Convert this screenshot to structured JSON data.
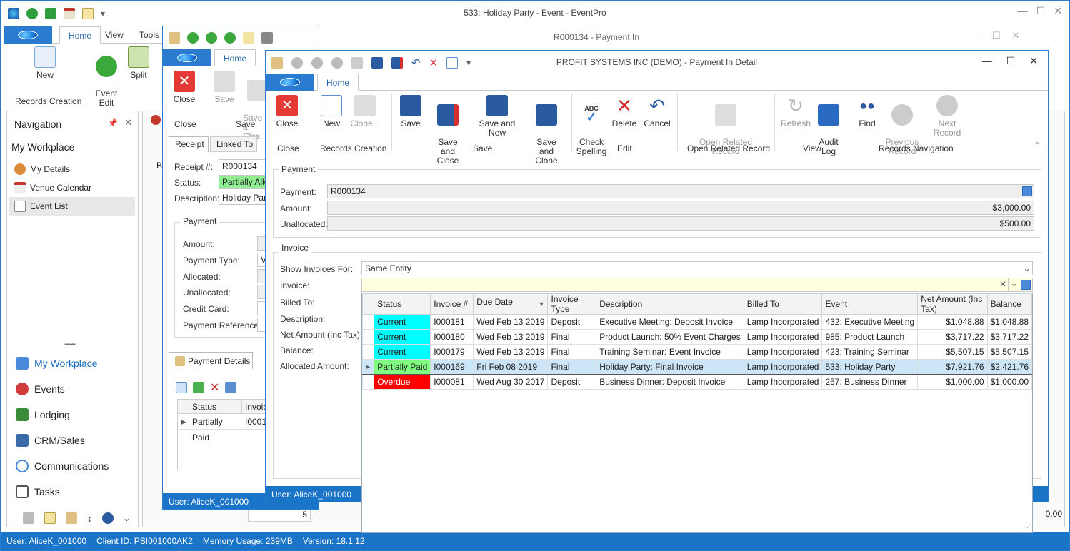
{
  "main": {
    "title": "533: Holiday Party - Event - EventPro",
    "tabs": [
      "Home",
      "View",
      "Tools"
    ],
    "ribbon": {
      "new": "New",
      "event_edit": "Event\nEdit",
      "split": "Split",
      "group": "Records Creation"
    },
    "navigation": {
      "title": "Navigation",
      "section": "My Workplace",
      "items": [
        "My Details",
        "Venue Calendar",
        "Event List"
      ],
      "modules": [
        "My Workplace",
        "Events",
        "Lodging",
        "CRM/Sales",
        "Communications",
        "Tasks"
      ]
    },
    "status": {
      "user": "User: AliceK_001000",
      "client": "Client ID: PSI001000AK2",
      "memory": "Memory Usage: 239MB",
      "version": "Version: 18.1.12"
    },
    "partial_text": {
      "be": "B",
      "value_5": "5",
      "value_00": "0.00"
    }
  },
  "payment_in": {
    "title": "R000134 - Payment In",
    "tab": "Home",
    "ribbon": {
      "close": "Close",
      "save": "Save",
      "save_close": "Save a\nClos",
      "g_close": "Close",
      "g_save": "Save"
    },
    "tabs": [
      "Receipt",
      "Linked To"
    ],
    "receipt_label": "Receipt #:",
    "receipt_value": "R000134",
    "status_label": "Status:",
    "status_value": "Partially Alloc",
    "description_label": "Description:",
    "description_value": "Holiday Party",
    "payment_group": "Payment",
    "payment_fields": [
      "Amount:",
      "Payment Type:",
      "Allocated:",
      "Unallocated:",
      "Credit Card:",
      "Payment Reference:"
    ],
    "payment_type_value": "VI",
    "details_tab": "Payment Details",
    "grid_headers": [
      "Status",
      "Invoic"
    ],
    "grid_row": {
      "status": "Partially Paid",
      "invoice": "I0001"
    },
    "status_bar": "User: AliceK_001000"
  },
  "detail": {
    "title": "PROFIT SYSTEMS INC (DEMO) - Payment In Detail",
    "tab": "Home",
    "ribbon": [
      {
        "label": "Close",
        "enabled": true
      },
      {
        "label": "New",
        "enabled": true
      },
      {
        "label": "Clone...",
        "enabled": false
      },
      {
        "label": "Save",
        "enabled": true
      },
      {
        "label": "Save and\nClose",
        "enabled": true
      },
      {
        "label": "Save and New",
        "enabled": true
      },
      {
        "label": "Save and\nClone",
        "enabled": true
      },
      {
        "label": "Check\nSpelling",
        "enabled": true
      },
      {
        "label": "Delete",
        "enabled": true
      },
      {
        "label": "Cancel",
        "enabled": true
      },
      {
        "label": "Open Related\nRecord",
        "enabled": false
      },
      {
        "label": "Refresh",
        "enabled": false
      },
      {
        "label": "Audit\nLog",
        "enabled": true
      },
      {
        "label": "Find",
        "enabled": true
      },
      {
        "label": "Previous\nRecord",
        "enabled": false
      },
      {
        "label": "Next Record",
        "enabled": false
      }
    ],
    "groups": [
      "Close",
      "Records Creation",
      "Save",
      "Edit",
      "Open Related Record",
      "View",
      "Records Navigation"
    ],
    "payment_group": "Payment",
    "payment_label": "Payment:",
    "payment_value": "R000134",
    "amount_label": "Amount:",
    "amount_value": "$3,000.00",
    "unallocated_label": "Unallocated:",
    "unallocated_value": "$500.00",
    "invoice_group": "Invoice",
    "show_for_label": "Show Invoices For:",
    "show_for_value": "Same Entity",
    "invoice_label": "Invoice:",
    "left_labels": [
      "Billed To:",
      "Description:",
      "Net Amount (Inc Tax):",
      "Balance:",
      "Allocated Amount:"
    ],
    "status_bar": "User: AliceK_001000"
  },
  "dropdown": {
    "columns": [
      "Status",
      "Invoice #",
      "Due Date",
      "Invoice Type",
      "Description",
      "Billed To",
      "Event",
      "Net Amount (Inc Tax)",
      "Balance"
    ],
    "rows": [
      {
        "status": "Current",
        "color": "#00ffff",
        "invoice": "I000181",
        "due": "Wed Feb 13 2019",
        "type": "Deposit",
        "description": "Executive Meeting: Deposit Invoice",
        "billed": "Lamp Incorporated",
        "event": "432: Executive Meeting",
        "net": "$1,048.88",
        "balance": "$1,048.88"
      },
      {
        "status": "Current",
        "color": "#00ffff",
        "invoice": "I000180",
        "due": "Wed Feb 13 2019",
        "type": "Final",
        "description": "Product Launch: 50% Event Charges",
        "billed": "Lamp Incorporated",
        "event": "985: Product Launch",
        "net": "$3,717.22",
        "balance": "$3,717.22"
      },
      {
        "status": "Current",
        "color": "#00ffff",
        "invoice": "I000179",
        "due": "Wed Feb 13 2019",
        "type": "Final",
        "description": "Training Seminar: Event Invoice",
        "billed": "Lamp Incorporated",
        "event": "423: Training Seminar",
        "net": "$5,507.15",
        "balance": "$5,507.15"
      },
      {
        "status": "Partially Paid",
        "color": "#80ff80",
        "invoice": "I000169",
        "due": "Fri Feb 08 2019",
        "type": "Final",
        "description": "Holiday Party: Final Invoice",
        "billed": "Lamp Incorporated",
        "event": "533: Holiday Party",
        "net": "$7,921.76",
        "balance": "$2,421.76"
      },
      {
        "status": "Overdue",
        "color": "#ff0000",
        "invoice": "I000081",
        "due": "Wed Aug 30 2017",
        "type": "Deposit",
        "description": "Business Dinner: Deposit Invoice",
        "billed": "Lamp Incorporated",
        "event": "257: Business Dinner",
        "net": "$1,000.00",
        "balance": "$1,000.00"
      }
    ]
  }
}
